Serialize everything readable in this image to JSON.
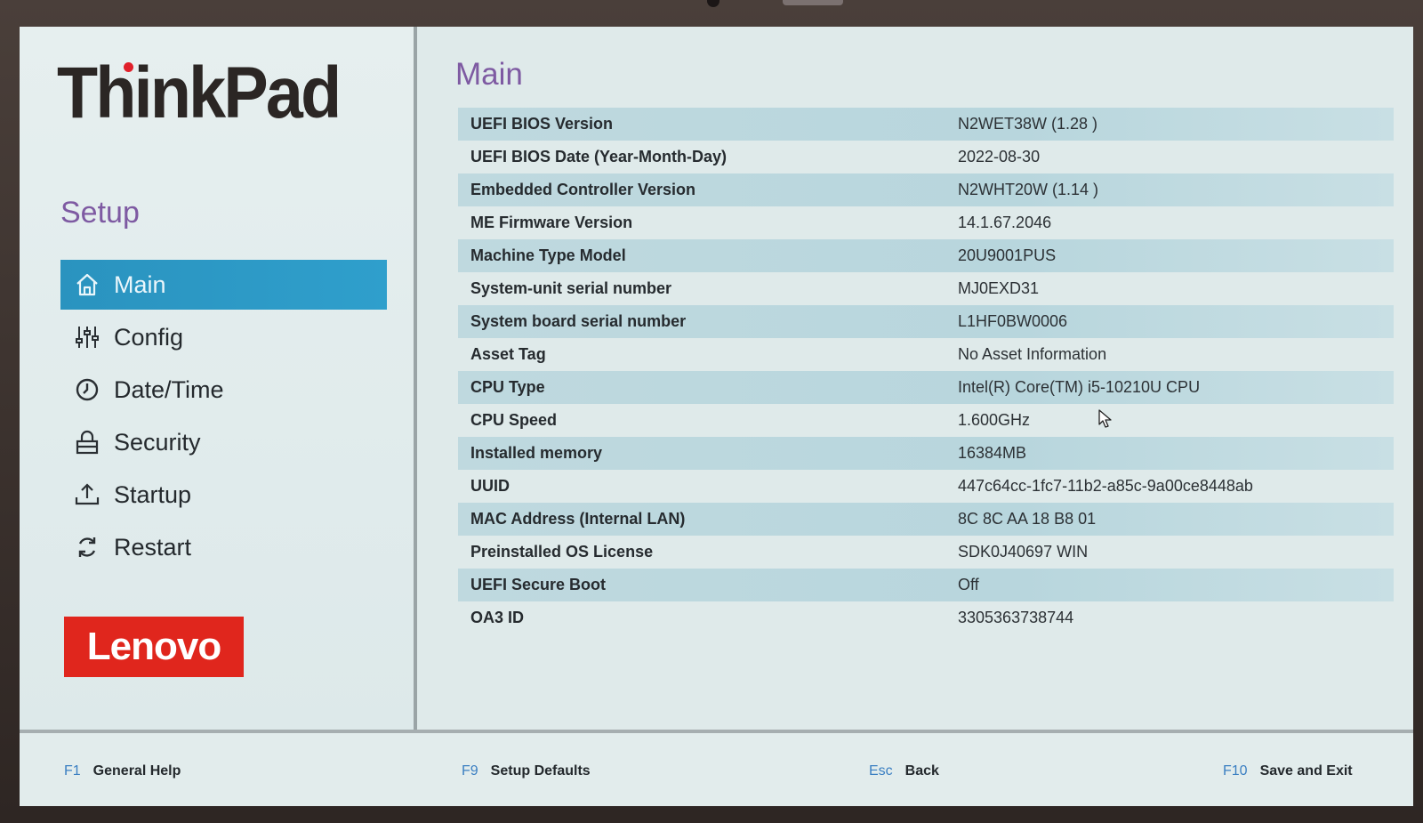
{
  "brand": {
    "product_logo": "ThinkPad",
    "vendor_logo": "Lenovo"
  },
  "sidebar": {
    "title": "Setup",
    "items": [
      {
        "label": "Main",
        "icon": "home-icon",
        "active": true
      },
      {
        "label": "Config",
        "icon": "sliders-icon",
        "active": false
      },
      {
        "label": "Date/Time",
        "icon": "clock-icon",
        "active": false
      },
      {
        "label": "Security",
        "icon": "lock-icon",
        "active": false
      },
      {
        "label": "Startup",
        "icon": "upload-icon",
        "active": false
      },
      {
        "label": "Restart",
        "icon": "restart-icon",
        "active": false
      }
    ]
  },
  "main": {
    "title": "Main",
    "rows": [
      {
        "label": "UEFI BIOS Version",
        "value": "N2WET38W (1.28 )"
      },
      {
        "label": "UEFI BIOS Date (Year-Month-Day)",
        "value": "2022-08-30"
      },
      {
        "label": "Embedded Controller Version",
        "value": "N2WHT20W (1.14 )"
      },
      {
        "label": "ME Firmware Version",
        "value": "14.1.67.2046"
      },
      {
        "label": "Machine Type Model",
        "value": "20U9001PUS"
      },
      {
        "label": "System-unit serial number",
        "value": "MJ0EXD31"
      },
      {
        "label": "System board serial number",
        "value": "L1HF0BW0006"
      },
      {
        "label": "Asset Tag",
        "value": "No Asset Information"
      },
      {
        "label": "CPU Type",
        "value": "Intel(R) Core(TM) i5-10210U CPU"
      },
      {
        "label": "CPU Speed",
        "value": "1.600GHz"
      },
      {
        "label": "Installed memory",
        "value": "16384MB"
      },
      {
        "label": "UUID",
        "value": "447c64cc-1fc7-11b2-a85c-9a00ce8448ab"
      },
      {
        "label": "MAC Address (Internal LAN)",
        "value": "8C 8C AA 18 B8 01"
      },
      {
        "label": "Preinstalled OS License",
        "value": "SDK0J40697 WIN"
      },
      {
        "label": "UEFI Secure Boot",
        "value": "Off"
      },
      {
        "label": "OA3 ID",
        "value": "3305363738744"
      }
    ]
  },
  "footer": {
    "keys": [
      {
        "key": "F1",
        "label": "General Help"
      },
      {
        "key": "F9",
        "label": "Setup Defaults"
      },
      {
        "key": "Esc",
        "label": "Back"
      },
      {
        "key": "F10",
        "label": "Save and Exit"
      }
    ]
  },
  "colors": {
    "accent_purple": "#7e5aa2",
    "active_blue": "#2a93bf",
    "row_band": "#bfd9df",
    "lenovo_red": "#e0261d",
    "fkey_blue": "#3b7fc2"
  }
}
